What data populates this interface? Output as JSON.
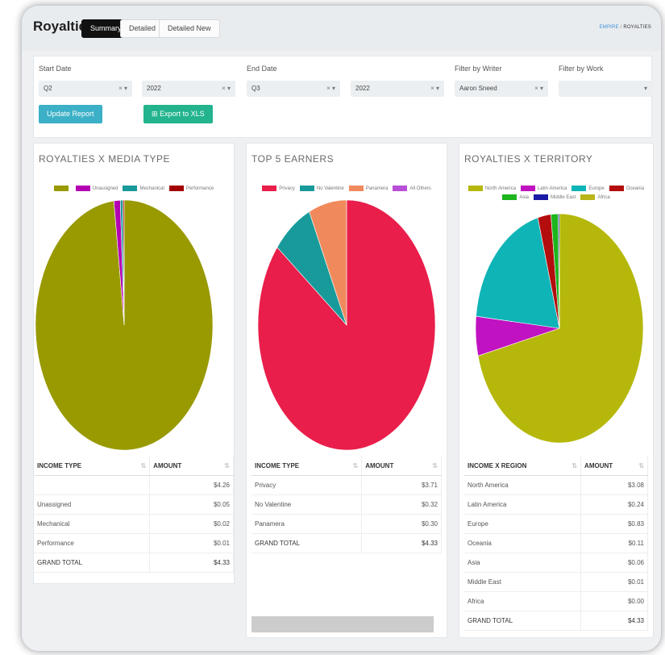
{
  "app": {
    "title": "Royalties"
  },
  "tabs": [
    {
      "label": "Summary"
    },
    {
      "label": "Detailed"
    },
    {
      "label": "Detailed New"
    }
  ],
  "breadcrumb": {
    "home": "EMPIRE",
    "separator": "/",
    "current": "ROYALTIES"
  },
  "filters": {
    "start_date_label": "Start Date",
    "end_date_label": "End Date",
    "writer_label": "Filter by Writer",
    "work_label": "Filter by Work",
    "start_quarter": "Q2",
    "start_year": "2022",
    "end_quarter": "Q3",
    "end_year": "2022",
    "writer": "Aaron Sneed",
    "work": "",
    "clear_icon": "×",
    "caret_icon": "▾"
  },
  "buttons": {
    "update": "Update Report",
    "export": "Export to XLS",
    "export_icon": "⊞"
  },
  "cards": {
    "media": {
      "title": "ROYALTIES X MEDIA TYPE",
      "legend": [
        {
          "label": "",
          "color": "#999900"
        },
        {
          "label": "Unassigned",
          "color": "#b300b3"
        },
        {
          "label": "Mechanical",
          "color": "#199a9a"
        },
        {
          "label": "Performance",
          "color": "#a30000"
        }
      ],
      "table": {
        "headers": [
          "INCOME TYPE",
          "AMOUNT"
        ],
        "rows": [
          [
            "",
            "$4.26"
          ],
          [
            "Unassigned",
            "$0.05"
          ],
          [
            "Mechanical",
            "$0.02"
          ],
          [
            "Performance",
            "$0.01"
          ],
          [
            "GRAND TOTAL",
            "$4.33"
          ]
        ]
      }
    },
    "earners": {
      "title": "TOP 5 EARNERS",
      "legend": [
        {
          "label": "Privacy",
          "color": "#e91e4a"
        },
        {
          "label": "No Valentine",
          "color": "#199a9a"
        },
        {
          "label": "Panamera",
          "color": "#f08a5d"
        },
        {
          "label": "All Others",
          "color": "#b84fd6"
        }
      ],
      "table": {
        "headers": [
          "INCOME TYPE",
          "AMOUNT"
        ],
        "rows": [
          [
            "Privacy",
            "$3.71"
          ],
          [
            "No Valentine",
            "$0.32"
          ],
          [
            "Panamera",
            "$0.30"
          ],
          [
            "GRAND TOTAL",
            "$4.33"
          ]
        ]
      }
    },
    "territory": {
      "title": "ROYALTIES X TERRITORY",
      "legend": [
        {
          "label": "North America",
          "color": "#b5b80a"
        },
        {
          "label": "Latin America",
          "color": "#c012c0"
        },
        {
          "label": "Europe",
          "color": "#0fb4b6"
        },
        {
          "label": "Oceania",
          "color": "#b30d0d"
        },
        {
          "label": "Asia",
          "color": "#1db51d"
        },
        {
          "label": "Middle East",
          "color": "#1a1aa6"
        },
        {
          "label": "Africa",
          "color": "#b9b518"
        }
      ],
      "table": {
        "headers": [
          "INCOME X REGION",
          "AMOUNT"
        ],
        "rows": [
          [
            "North America",
            "$3.08"
          ],
          [
            "Latin America",
            "$0.24"
          ],
          [
            "Europe",
            "$0.83"
          ],
          [
            "Oceania",
            "$0.11"
          ],
          [
            "Asia",
            "$0.06"
          ],
          [
            "Middle East",
            "$0.01"
          ],
          [
            "Africa",
            "$0.00"
          ],
          [
            "GRAND TOTAL",
            "$4.33"
          ]
        ]
      }
    }
  },
  "chart_data": [
    {
      "type": "pie",
      "title": "ROYALTIES X MEDIA TYPE",
      "categories": [
        "",
        "Unassigned",
        "Mechanical",
        "Performance"
      ],
      "values": [
        4.26,
        0.05,
        0.02,
        0.01
      ],
      "legend": "top"
    },
    {
      "type": "pie",
      "title": "TOP 5 EARNERS",
      "categories": [
        "Privacy",
        "No Valentine",
        "Panamera",
        "All Others"
      ],
      "values": [
        3.71,
        0.32,
        0.3,
        0.0
      ],
      "legend": "top"
    },
    {
      "type": "pie",
      "title": "ROYALTIES X TERRITORY",
      "categories": [
        "North America",
        "Latin America",
        "Europe",
        "Oceania",
        "Asia",
        "Middle East",
        "Africa"
      ],
      "values": [
        3.08,
        0.24,
        0.83,
        0.11,
        0.06,
        0.01,
        0.0
      ],
      "legend": "top"
    }
  ]
}
